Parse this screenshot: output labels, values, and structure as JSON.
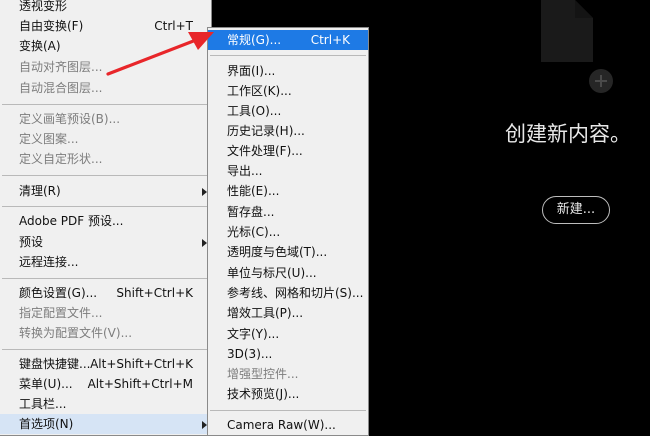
{
  "edit_menu": {
    "items": [
      {
        "label": "透视变形",
        "shortcut": "",
        "disabled": false
      },
      {
        "label": "自由变换(F)",
        "shortcut": "Ctrl+T",
        "disabled": false
      },
      {
        "label": "变换(A)",
        "shortcut": "",
        "disabled": false
      },
      {
        "label": "自动对齐图层...",
        "shortcut": "",
        "disabled": true
      },
      {
        "label": "自动混合图层...",
        "shortcut": "",
        "disabled": true
      },
      {
        "label": "定义画笔预设(B)...",
        "shortcut": "",
        "disabled": true
      },
      {
        "label": "定义图案...",
        "shortcut": "",
        "disabled": true
      },
      {
        "label": "定义自定形状...",
        "shortcut": "",
        "disabled": true
      },
      {
        "label": "清理(R)",
        "shortcut": "",
        "disabled": false
      },
      {
        "label": "Adobe PDF 预设...",
        "shortcut": "",
        "disabled": false
      },
      {
        "label": "预设",
        "shortcut": "",
        "disabled": false
      },
      {
        "label": "远程连接...",
        "shortcut": "",
        "disabled": false
      },
      {
        "label": "颜色设置(G)...",
        "shortcut": "Shift+Ctrl+K",
        "disabled": false
      },
      {
        "label": "指定配置文件...",
        "shortcut": "",
        "disabled": true
      },
      {
        "label": "转换为配置文件(V)...",
        "shortcut": "",
        "disabled": true
      },
      {
        "label": "键盘快捷键...",
        "shortcut": "Alt+Shift+Ctrl+K",
        "disabled": false
      },
      {
        "label": "菜单(U)...",
        "shortcut": "Alt+Shift+Ctrl+M",
        "disabled": false
      },
      {
        "label": "工具栏...",
        "shortcut": "",
        "disabled": false
      },
      {
        "label": "首选项(N)",
        "shortcut": "",
        "disabled": false
      }
    ]
  },
  "prefs_submenu": {
    "items": [
      {
        "label": "常规(G)...",
        "shortcut": "Ctrl+K",
        "disabled": false
      },
      {
        "label": "界面(I)...",
        "shortcut": "",
        "disabled": false
      },
      {
        "label": "工作区(K)...",
        "shortcut": "",
        "disabled": false
      },
      {
        "label": "工具(O)...",
        "shortcut": "",
        "disabled": false
      },
      {
        "label": "历史记录(H)...",
        "shortcut": "",
        "disabled": false
      },
      {
        "label": "文件处理(F)...",
        "shortcut": "",
        "disabled": false
      },
      {
        "label": "导出...",
        "shortcut": "",
        "disabled": false
      },
      {
        "label": "性能(E)...",
        "shortcut": "",
        "disabled": false
      },
      {
        "label": "暂存盘...",
        "shortcut": "",
        "disabled": false
      },
      {
        "label": "光标(C)...",
        "shortcut": "",
        "disabled": false
      },
      {
        "label": "透明度与色域(T)...",
        "shortcut": "",
        "disabled": false
      },
      {
        "label": "单位与标尺(U)...",
        "shortcut": "",
        "disabled": false
      },
      {
        "label": "参考线、网格和切片(S)...",
        "shortcut": "",
        "disabled": false
      },
      {
        "label": "增效工具(P)...",
        "shortcut": "",
        "disabled": false
      },
      {
        "label": "文字(Y)...",
        "shortcut": "",
        "disabled": false
      },
      {
        "label": "3D(3)...",
        "shortcut": "",
        "disabled": false
      },
      {
        "label": "增强型控件...",
        "shortcut": "",
        "disabled": true
      },
      {
        "label": "技术预览(J)...",
        "shortcut": "",
        "disabled": false
      },
      {
        "label": "Camera Raw(W)...",
        "shortcut": "",
        "disabled": false
      }
    ]
  },
  "welcome": {
    "title": "创建新内容。",
    "new_button": "新建..."
  },
  "colors": {
    "menu_bg": "#f0f0f0",
    "selection": "#1e7ae5",
    "annotation_arrow": "#e8262a",
    "canvas_bg": "#000000"
  }
}
